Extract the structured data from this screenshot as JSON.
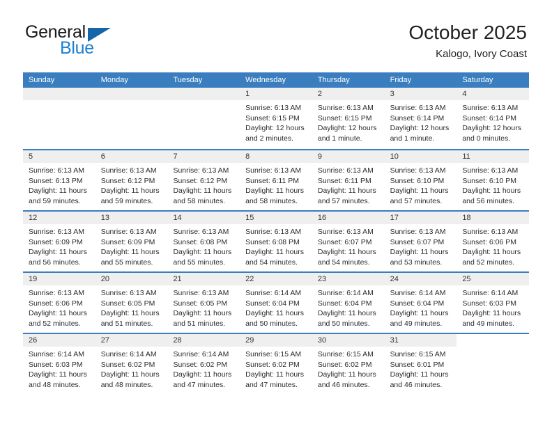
{
  "brand": {
    "word_top": "General",
    "word_bottom": "Blue",
    "triangle_color": "#1565a8",
    "blue_color": "#1a7fd4"
  },
  "header": {
    "title": "October 2025",
    "subtitle": "Kalogo, Ivory Coast",
    "accent_color": "#3a7ebf"
  },
  "calendar": {
    "weekday_headers": [
      "Sunday",
      "Monday",
      "Tuesday",
      "Wednesday",
      "Thursday",
      "Friday",
      "Saturday"
    ],
    "weeks": [
      [
        {
          "day": "",
          "empty": true,
          "lines": []
        },
        {
          "day": "",
          "empty": true,
          "lines": []
        },
        {
          "day": "",
          "empty": true,
          "lines": []
        },
        {
          "day": "1",
          "lines": [
            "Sunrise: 6:13 AM",
            "Sunset: 6:15 PM",
            "Daylight: 12 hours",
            "and 2 minutes."
          ]
        },
        {
          "day": "2",
          "lines": [
            "Sunrise: 6:13 AM",
            "Sunset: 6:15 PM",
            "Daylight: 12 hours",
            "and 1 minute."
          ]
        },
        {
          "day": "3",
          "lines": [
            "Sunrise: 6:13 AM",
            "Sunset: 6:14 PM",
            "Daylight: 12 hours",
            "and 1 minute."
          ]
        },
        {
          "day": "4",
          "lines": [
            "Sunrise: 6:13 AM",
            "Sunset: 6:14 PM",
            "Daylight: 12 hours",
            "and 0 minutes."
          ]
        }
      ],
      [
        {
          "day": "5",
          "lines": [
            "Sunrise: 6:13 AM",
            "Sunset: 6:13 PM",
            "Daylight: 11 hours",
            "and 59 minutes."
          ]
        },
        {
          "day": "6",
          "lines": [
            "Sunrise: 6:13 AM",
            "Sunset: 6:12 PM",
            "Daylight: 11 hours",
            "and 59 minutes."
          ]
        },
        {
          "day": "7",
          "lines": [
            "Sunrise: 6:13 AM",
            "Sunset: 6:12 PM",
            "Daylight: 11 hours",
            "and 58 minutes."
          ]
        },
        {
          "day": "8",
          "lines": [
            "Sunrise: 6:13 AM",
            "Sunset: 6:11 PM",
            "Daylight: 11 hours",
            "and 58 minutes."
          ]
        },
        {
          "day": "9",
          "lines": [
            "Sunrise: 6:13 AM",
            "Sunset: 6:11 PM",
            "Daylight: 11 hours",
            "and 57 minutes."
          ]
        },
        {
          "day": "10",
          "lines": [
            "Sunrise: 6:13 AM",
            "Sunset: 6:10 PM",
            "Daylight: 11 hours",
            "and 57 minutes."
          ]
        },
        {
          "day": "11",
          "lines": [
            "Sunrise: 6:13 AM",
            "Sunset: 6:10 PM",
            "Daylight: 11 hours",
            "and 56 minutes."
          ]
        }
      ],
      [
        {
          "day": "12",
          "lines": [
            "Sunrise: 6:13 AM",
            "Sunset: 6:09 PM",
            "Daylight: 11 hours",
            "and 56 minutes."
          ]
        },
        {
          "day": "13",
          "lines": [
            "Sunrise: 6:13 AM",
            "Sunset: 6:09 PM",
            "Daylight: 11 hours",
            "and 55 minutes."
          ]
        },
        {
          "day": "14",
          "lines": [
            "Sunrise: 6:13 AM",
            "Sunset: 6:08 PM",
            "Daylight: 11 hours",
            "and 55 minutes."
          ]
        },
        {
          "day": "15",
          "lines": [
            "Sunrise: 6:13 AM",
            "Sunset: 6:08 PM",
            "Daylight: 11 hours",
            "and 54 minutes."
          ]
        },
        {
          "day": "16",
          "lines": [
            "Sunrise: 6:13 AM",
            "Sunset: 6:07 PM",
            "Daylight: 11 hours",
            "and 54 minutes."
          ]
        },
        {
          "day": "17",
          "lines": [
            "Sunrise: 6:13 AM",
            "Sunset: 6:07 PM",
            "Daylight: 11 hours",
            "and 53 minutes."
          ]
        },
        {
          "day": "18",
          "lines": [
            "Sunrise: 6:13 AM",
            "Sunset: 6:06 PM",
            "Daylight: 11 hours",
            "and 52 minutes."
          ]
        }
      ],
      [
        {
          "day": "19",
          "lines": [
            "Sunrise: 6:13 AM",
            "Sunset: 6:06 PM",
            "Daylight: 11 hours",
            "and 52 minutes."
          ]
        },
        {
          "day": "20",
          "lines": [
            "Sunrise: 6:13 AM",
            "Sunset: 6:05 PM",
            "Daylight: 11 hours",
            "and 51 minutes."
          ]
        },
        {
          "day": "21",
          "lines": [
            "Sunrise: 6:13 AM",
            "Sunset: 6:05 PM",
            "Daylight: 11 hours",
            "and 51 minutes."
          ]
        },
        {
          "day": "22",
          "lines": [
            "Sunrise: 6:14 AM",
            "Sunset: 6:04 PM",
            "Daylight: 11 hours",
            "and 50 minutes."
          ]
        },
        {
          "day": "23",
          "lines": [
            "Sunrise: 6:14 AM",
            "Sunset: 6:04 PM",
            "Daylight: 11 hours",
            "and 50 minutes."
          ]
        },
        {
          "day": "24",
          "lines": [
            "Sunrise: 6:14 AM",
            "Sunset: 6:04 PM",
            "Daylight: 11 hours",
            "and 49 minutes."
          ]
        },
        {
          "day": "25",
          "lines": [
            "Sunrise: 6:14 AM",
            "Sunset: 6:03 PM",
            "Daylight: 11 hours",
            "and 49 minutes."
          ]
        }
      ],
      [
        {
          "day": "26",
          "lines": [
            "Sunrise: 6:14 AM",
            "Sunset: 6:03 PM",
            "Daylight: 11 hours",
            "and 48 minutes."
          ]
        },
        {
          "day": "27",
          "lines": [
            "Sunrise: 6:14 AM",
            "Sunset: 6:02 PM",
            "Daylight: 11 hours",
            "and 48 minutes."
          ]
        },
        {
          "day": "28",
          "lines": [
            "Sunrise: 6:14 AM",
            "Sunset: 6:02 PM",
            "Daylight: 11 hours",
            "and 47 minutes."
          ]
        },
        {
          "day": "29",
          "lines": [
            "Sunrise: 6:15 AM",
            "Sunset: 6:02 PM",
            "Daylight: 11 hours",
            "and 47 minutes."
          ]
        },
        {
          "day": "30",
          "lines": [
            "Sunrise: 6:15 AM",
            "Sunset: 6:02 PM",
            "Daylight: 11 hours",
            "and 46 minutes."
          ]
        },
        {
          "day": "31",
          "lines": [
            "Sunrise: 6:15 AM",
            "Sunset: 6:01 PM",
            "Daylight: 11 hours",
            "and 46 minutes."
          ]
        },
        {
          "day": "",
          "blank": true,
          "lines": []
        }
      ]
    ]
  }
}
